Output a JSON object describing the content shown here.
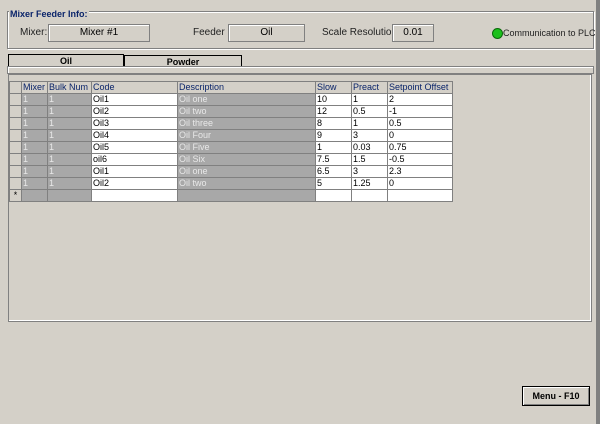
{
  "header": {
    "title": "Mixer Feeder Info:",
    "mixer_label": "Mixer:",
    "mixer_value": "Mixer #1",
    "feeder_label": "Feeder",
    "feeder_value": "Oil",
    "scale_label": "Scale Resolution:",
    "scale_value": "0.01",
    "comm_label": "Communication to PLC",
    "comm_color": "#1cc01c"
  },
  "tabs": [
    {
      "label": "Oil",
      "active": true
    },
    {
      "label": "Powder",
      "active": false
    }
  ],
  "grid": {
    "columns": [
      "Mixer",
      "Bulk Num",
      "Code",
      "Description",
      "Slow",
      "Preact",
      "Setpoint Offset"
    ],
    "rows": [
      [
        "1",
        "1",
        "Oil1",
        "Oil one",
        "10",
        "1",
        "2"
      ],
      [
        "1",
        "1",
        "Oil2",
        "Oil two",
        "12",
        "0.5",
        "-1"
      ],
      [
        "1",
        "1",
        "Oil3",
        "Oil three",
        "8",
        "1",
        "0.5"
      ],
      [
        "1",
        "1",
        "Oil4",
        "Oil Four",
        "9",
        "3",
        "0"
      ],
      [
        "1",
        "1",
        "Oil5",
        "Oil Five",
        "1",
        "0.03",
        "0.75"
      ],
      [
        "1",
        "1",
        "oil6",
        "Oil Six",
        "7.5",
        "1.5",
        "-0.5"
      ],
      [
        "1",
        "1",
        "Oil1",
        "Oil one",
        "6.5",
        "3",
        "2.3"
      ],
      [
        "1",
        "1",
        "Oil2",
        "Oil two",
        "5",
        "1.25",
        "0"
      ]
    ],
    "new_row_marker": "*"
  },
  "footer": {
    "menu_button": "Menu - F10"
  }
}
